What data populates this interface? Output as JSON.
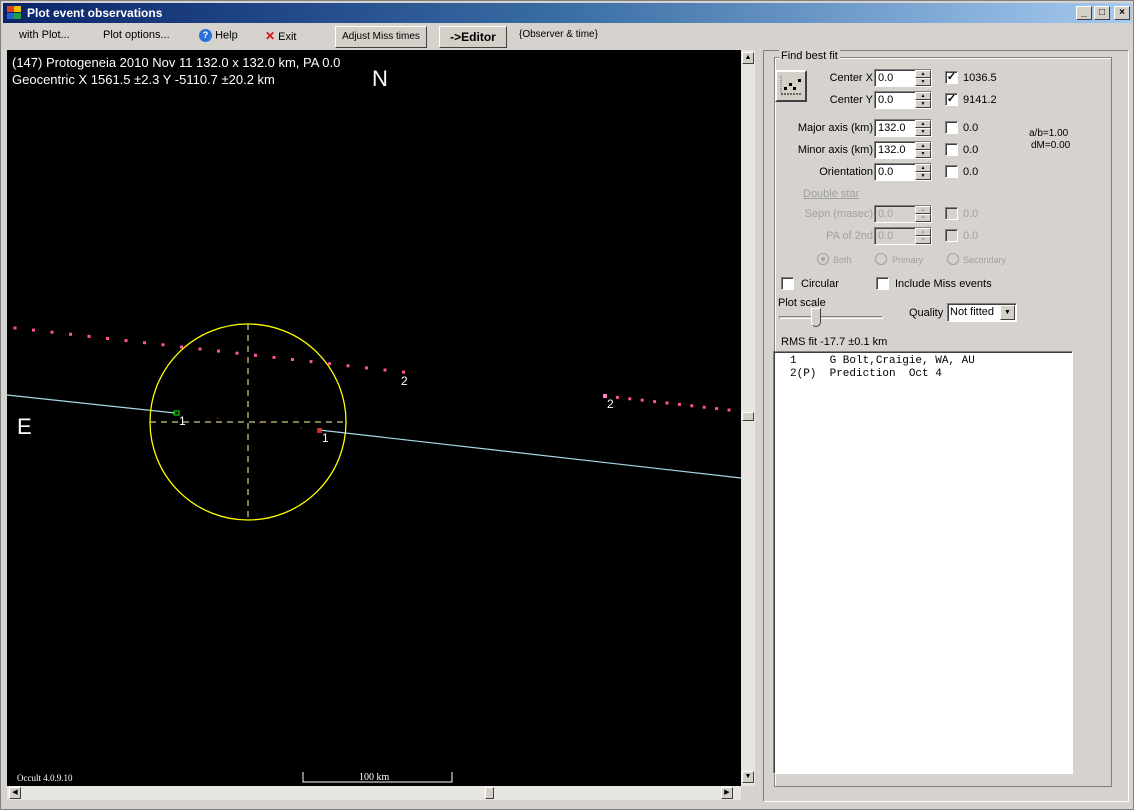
{
  "window": {
    "title": "Plot event observations",
    "controls": [
      "_",
      "□",
      "×"
    ]
  },
  "menu": {
    "with_plot": "with Plot...",
    "plot_options": "Plot options...",
    "help": "Help",
    "exit": "Exit",
    "adjust_miss_times": "Adjust Miss times",
    "editor": "->Editor",
    "observer_time": "{Observer & time}"
  },
  "plot": {
    "header_line1": "(147) Protogeneia  2010 Nov 11   132.0 x 132.0 km, PA 0.0",
    "header_line2": "Geocentric X  1561.5 ±2.3  Y -5110.7 ±20.2 km",
    "north_label": "N",
    "east_label": "E",
    "version": "Occult 4.0.9.10",
    "scale_bar_label": "100 km",
    "chord_labels": {
      "obs1_disappear": "1",
      "obs1_reappear": "1",
      "pred_end_left": "2",
      "pred_end_right": "2"
    },
    "colors": {
      "background": "#000000",
      "asteroid_outline": "#ffff00",
      "axis_dash": "#ffff99",
      "chord": "#a8d8e8",
      "prediction_dots": "#ff4fa0",
      "disappear_marker": "#00ff00",
      "reappear_marker": "#ff3030"
    }
  },
  "fit_panel": {
    "group_title": "Find best fit",
    "center_x": {
      "label": "Center X",
      "value": "0.0",
      "checked": true,
      "result": "1036.5"
    },
    "center_y": {
      "label": "Center Y",
      "value": "0.0",
      "checked": true,
      "result": "9141.2"
    },
    "major_axis": {
      "label": "Major axis (km)",
      "value": "132.0",
      "checked": false,
      "result": "0.0"
    },
    "minor_axis": {
      "label": "Minor axis (km)",
      "value": "132.0",
      "checked": false,
      "result": "0.0"
    },
    "orientation": {
      "label": "Orientation",
      "value": "0.0",
      "checked": false,
      "result": "0.0"
    },
    "ratio": "a/b=1.00",
    "dm": "dM=0.00",
    "double_star": {
      "title": "Double star",
      "sepn": {
        "label": "Sepn (masec)",
        "value": "0.0",
        "result": "0.0"
      },
      "pa2": {
        "label": "PA of 2nd",
        "value": "0.0",
        "result": "0.0"
      },
      "radio_both": "Both",
      "radio_primary": "Primary",
      "radio_secondary": "Secondary",
      "selected": "Both"
    },
    "circular": {
      "label": "Circular",
      "checked": false
    },
    "include_miss": {
      "label": "Include Miss events",
      "checked": false
    },
    "plot_scale_label": "Plot scale",
    "quality_label": "Quality",
    "quality_value": "Not fitted",
    "rms_fit": "RMS fit -17.7 ±0.1 km"
  },
  "observers": [
    {
      "num": "1",
      "text": "1     G Bolt,Craigie, WA, AU"
    },
    {
      "num": "2(P)",
      "text": "2(P)  Prediction  Oct 4"
    }
  ]
}
